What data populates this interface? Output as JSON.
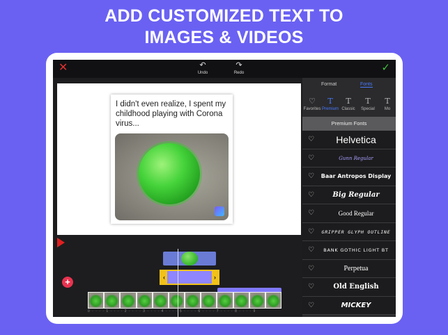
{
  "headline": {
    "line1": "ADD CUSTOMIZED TEXT TO",
    "line2": "IMAGES & VIDEOS"
  },
  "topbar": {
    "close_icon": "✕",
    "undo_label": "Undo",
    "redo_label": "Redo",
    "undo_icon": "↶",
    "redo_icon": "↷",
    "done_icon": "✓"
  },
  "canvas": {
    "meme_text": "I didn't even realize, I spent my childhood playing with Corona virus..."
  },
  "panel": {
    "tabs": [
      "Format",
      "Fonts"
    ],
    "categories": [
      {
        "icon": "♡",
        "label": "Favorites"
      },
      {
        "icon": "T",
        "label": "Premium"
      },
      {
        "icon": "T",
        "label": "Classic"
      },
      {
        "icon": "T",
        "label": "Special"
      },
      {
        "icon": "T",
        "label": "Mo"
      }
    ],
    "section_title": "Premium Fonts",
    "fonts": [
      "Helvetica",
      "Gunn Regular",
      "Baar Antropos Display",
      "Big Regular",
      "Good Regular",
      "GRIPPER GLYPH OUTLINE",
      "Bank Gothic Light BT",
      "Perpetua",
      "Old English",
      "Mickey"
    ]
  },
  "timeline": {
    "add_icon": "+",
    "ruler": "0 · · · · 1 · · · · 2 · · · · 3 · · · · 4 · · · · 5 · · · · 6 · · · · 7 · · · · 8 · · · · 9",
    "handle_left": "‹",
    "handle_right": "›"
  },
  "colors": {
    "background": "#6a61f3",
    "accent": "#4a7bff",
    "close": "#e03030",
    "done": "#3fbf3f",
    "track": "#8f86ff",
    "handle": "#f2c21a"
  }
}
